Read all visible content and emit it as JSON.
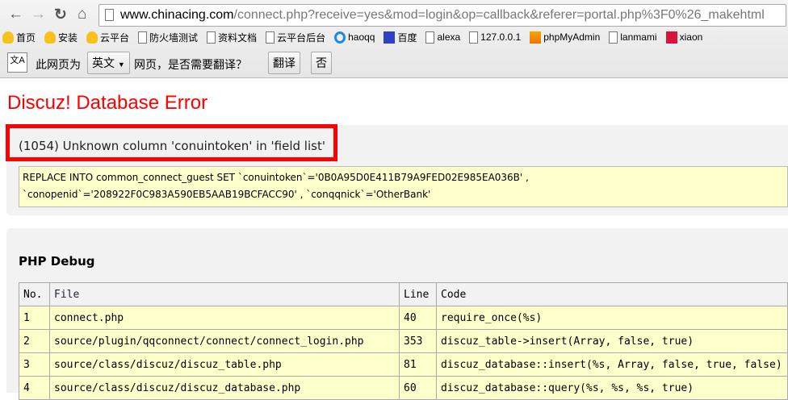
{
  "browser": {
    "url_host": "www.chinacing.com",
    "url_path": "/connect.php?receive=yes&mod=login&op=callback&referer=portal.php%3F0%26_makehtml",
    "bookmarks": [
      {
        "label": "首页",
        "icon": "bulb"
      },
      {
        "label": "安装",
        "icon": "bulb"
      },
      {
        "label": "云平台",
        "icon": "bulb"
      },
      {
        "label": "防火墙测试",
        "icon": "doc"
      },
      {
        "label": "资料文档",
        "icon": "doc"
      },
      {
        "label": "云平台后台",
        "icon": "doc"
      },
      {
        "label": "haoqq",
        "icon": "ie"
      },
      {
        "label": "百度",
        "icon": "paw"
      },
      {
        "label": "alexa",
        "icon": "doc"
      },
      {
        "label": "127.0.0.1",
        "icon": "doc"
      },
      {
        "label": "phpMyAdmin",
        "icon": "pma"
      },
      {
        "label": "lanmami",
        "icon": "doc"
      },
      {
        "label": "xiaon",
        "icon": "hang"
      }
    ]
  },
  "translate": {
    "icon_label": "文A",
    "prefix": "此网页为",
    "language": "英文",
    "suffix": "网页，是否需要翻译？",
    "translate_button": "翻译",
    "no_button": "否"
  },
  "page": {
    "title": "Discuz! Database Error",
    "error": "(1054) Unknown column 'conuintoken' in 'field list'",
    "sql_line1": "REPLACE INTO common_connect_guest SET `conuintoken`='0B0A95D0E411B79A9FED02E985EA036B' ,",
    "sql_line2": "`conopenid`='208922F0C983A590EB5AAB19BCFACC90' , `conqqnick`='OtherBank'",
    "debug_title": "PHP Debug",
    "headers": [
      "No.",
      "File",
      "Line",
      "Code"
    ],
    "rows": [
      [
        "1",
        "connect.php",
        "40",
        "require_once(%s)"
      ],
      [
        "2",
        "source/plugin/qqconnect/connect/connect_login.php",
        "353",
        "discuz_table->insert(Array, false, true)"
      ],
      [
        "3",
        "source/class/discuz/discuz_table.php",
        "81",
        "discuz_database::insert(%s, Array, false, true, false)"
      ],
      [
        "4",
        "source/class/discuz/discuz_database.php",
        "60",
        "discuz_database::query(%s, %s, %s, true)"
      ]
    ]
  }
}
